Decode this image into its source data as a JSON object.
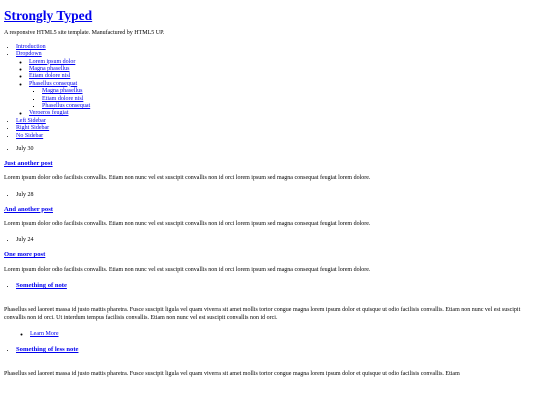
{
  "site": {
    "title": "Strongly Typed",
    "tagline": "A responsive HTML5 site template. Manufactured by HTML5 UP."
  },
  "nav": {
    "introduction": "Introduction",
    "dropdown": "Dropdown",
    "dropdown_items": {
      "lorem": "Lorem ipsum dolor",
      "magna": "Magna phasellus",
      "etiam": "Etiam dolore nisl",
      "phasellus": "Phasellus consequat",
      "sub_items": [
        "Magna phasellus",
        "Etiam dolore nisl",
        "Phasellus consequat"
      ],
      "veroeros": "Veroeros feugiat"
    },
    "left_sidebar": "Left Sidebar",
    "right_sidebar": "Right Sidebar",
    "no_sidebar": "No Sidebar"
  },
  "posts": [
    {
      "date": "July 30",
      "title": "Just another post",
      "excerpt": "Lorem ipsum dolor odio facilisis convallis. Etiam non nunc vel est suscipit convallis non id orci lorem ipsum sed magna consequat feugiat lorem dolore."
    },
    {
      "date": "July 28",
      "title": "And another post",
      "excerpt": "Lorem ipsum dolor odio facilisis convallis. Etiam non nunc vel est suscipit convallis non id orci lorem ipsum sed magna consequat feugiat lorem dolore."
    },
    {
      "date": "July 24",
      "title": "One more post",
      "excerpt": "Lorem ipsum dolor odio facilisis convallis. Etiam non nunc vel est suscipit convallis non id orci lorem ipsum sed magna consequat feugiat lorem dolore."
    }
  ],
  "features": [
    {
      "title": "Something of note",
      "text": "Phasellus sed laoreet massa id justo mattis pharetra. Fusce suscipit ligula vel quam viverra sit amet mollis tortor congue magna lorem ipsum dolor et quisque ut odio facilisis convallis. Etiam non nunc vel est suscipit convallis non id orci. Ut interdum tempus facilisis convallis. Etiam non nunc vel est suscipit convallis non id orci.",
      "more": "Learn More"
    },
    {
      "title": "Something of less note",
      "text": "Phasellus sed laoreet massa id justo mattis pharetra. Fusce suscipit ligula vel quam viverra sit amet mollis tortor congue magna lorem ipsum dolor et quisque ut odio facilisis convallis. Etiam"
    }
  ]
}
